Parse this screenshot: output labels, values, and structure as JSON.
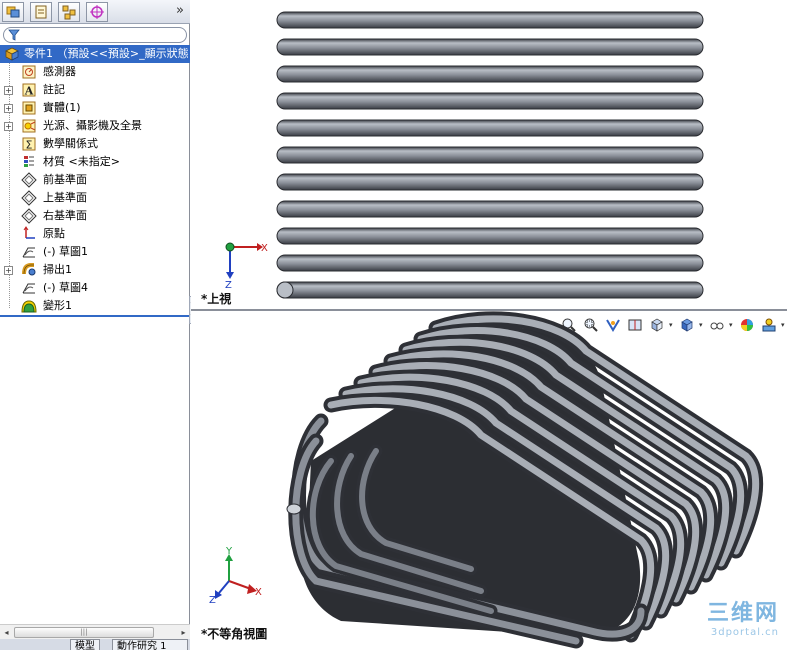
{
  "tabs": [
    "feature-manager",
    "property-manager",
    "configuration-manager",
    "dimxpert-manager"
  ],
  "more_symbol": "»",
  "tree": {
    "root": "零件1 （預設<<預設>_顯示狀態",
    "items": [
      {
        "label": "感測器",
        "icon": "sensor-icon",
        "expand": false
      },
      {
        "label": "註記",
        "icon": "annotation-icon",
        "expand": true
      },
      {
        "label": "實體(1)",
        "icon": "solid-body-icon",
        "expand": true
      },
      {
        "label": "光源、攝影機及全景",
        "icon": "lights-icon",
        "expand": true
      },
      {
        "label": "數學關係式",
        "icon": "equation-icon",
        "expand": false
      },
      {
        "label": "材質 <未指定>",
        "icon": "material-icon",
        "expand": false
      },
      {
        "label": "前基準面",
        "icon": "plane-icon",
        "expand": false
      },
      {
        "label": "上基準面",
        "icon": "plane-icon",
        "expand": false
      },
      {
        "label": "右基準面",
        "icon": "plane-icon",
        "expand": false
      },
      {
        "label": "原點",
        "icon": "origin-icon",
        "expand": false
      },
      {
        "label": "(-) 草圖1",
        "icon": "sketch-icon",
        "expand": false
      },
      {
        "label": "掃出1",
        "icon": "sweep-icon",
        "expand": true
      },
      {
        "label": "(-) 草圖4",
        "icon": "sketch-icon",
        "expand": false
      },
      {
        "label": "變形1",
        "icon": "deform-icon",
        "expand": false
      }
    ]
  },
  "scroll": {
    "left": "◂",
    "right": "▸",
    "grip": "|||"
  },
  "bottom_tabs": [
    "模型",
    "動作研究 1"
  ],
  "viewports": {
    "top_name": "*上視",
    "bottom_name": "*不等角視圖",
    "axis_x": "X",
    "axis_y": "Y",
    "axis_z": "Z"
  },
  "toolbar": [
    "zoom-to-fit-icon",
    "zoom-area-icon",
    "previous-view-icon",
    "section-view-icon",
    "view-orientation-icon",
    "display-style-icon",
    "hide-show-icon",
    "appearance-icon",
    "scene-icon"
  ],
  "watermark": {
    "title": "三维网",
    "url": "3dportal.cn"
  },
  "colors": {
    "selection": "#3169c6",
    "pipe": "#6a6f78",
    "pipe_light": "#a9aeb6",
    "pipe_dark": "#3a3d44"
  }
}
